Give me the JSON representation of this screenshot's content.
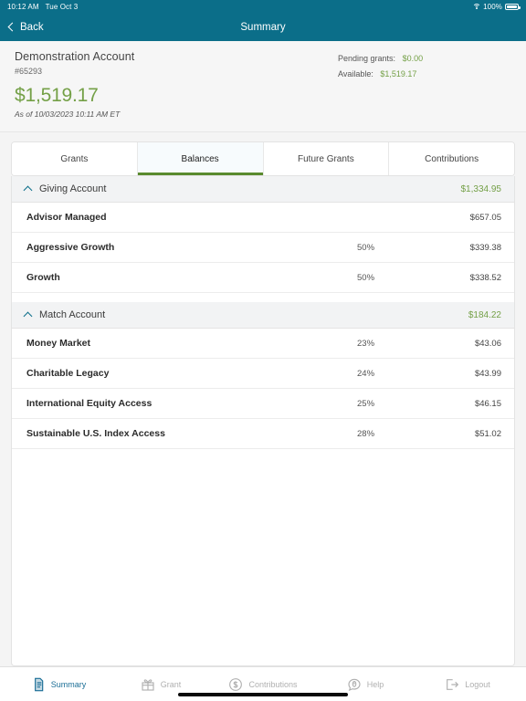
{
  "status_bar": {
    "time": "10:12 AM",
    "date": "Tue Oct 3",
    "battery_percent": "100%",
    "wifi_icon": "wifi-icon",
    "battery_icon": "battery-icon"
  },
  "nav": {
    "back_label": "Back",
    "back_icon": "chevron-left-icon",
    "title": "Summary"
  },
  "account": {
    "name": "Demonstration Account",
    "number": "#65293",
    "balance": "$1,519.17",
    "as_of": "As of 10/03/2023 10:11 AM ET",
    "pending_grants_label": "Pending grants:",
    "pending_grants_value": "$0.00",
    "available_label": "Available:",
    "available_value": "$1,519.17"
  },
  "tabs": [
    {
      "label": "Grants",
      "active": false
    },
    {
      "label": "Balances",
      "active": true
    },
    {
      "label": "Future Grants",
      "active": false
    },
    {
      "label": "Contributions",
      "active": false
    }
  ],
  "sections": [
    {
      "title": "Giving Account",
      "amount": "$1,334.95",
      "collapse_icon": "caret-up-icon",
      "rows": [
        {
          "name": "Advisor Managed",
          "percent": "",
          "amount": "$657.05"
        },
        {
          "name": "Aggressive Growth",
          "percent": "50%",
          "amount": "$339.38"
        },
        {
          "name": "Growth",
          "percent": "50%",
          "amount": "$338.52"
        }
      ]
    },
    {
      "title": "Match Account",
      "amount": "$184.22",
      "collapse_icon": "caret-up-icon",
      "rows": [
        {
          "name": "Money Market",
          "percent": "23%",
          "amount": "$43.06"
        },
        {
          "name": "Charitable Legacy",
          "percent": "24%",
          "amount": "$43.99"
        },
        {
          "name": "International Equity Access",
          "percent": "25%",
          "amount": "$46.15"
        },
        {
          "name": "Sustainable U.S. Index Access",
          "percent": "28%",
          "amount": "$51.02"
        }
      ]
    }
  ],
  "bottom_bar": [
    {
      "label": "Summary",
      "icon": "document-icon",
      "active": true
    },
    {
      "label": "Grant",
      "icon": "gift-icon",
      "active": false
    },
    {
      "label": "Contributions",
      "icon": "dollar-circle-icon",
      "active": false
    },
    {
      "label": "Help",
      "icon": "help-bubble-icon",
      "active": false
    },
    {
      "label": "Logout",
      "icon": "logout-icon",
      "active": false
    }
  ],
  "colors": {
    "brand_teal": "#0b6e89",
    "accent_green": "#74a047",
    "tab_underline_green": "#5a8a2e",
    "active_tab_text": "#1b6e96"
  }
}
